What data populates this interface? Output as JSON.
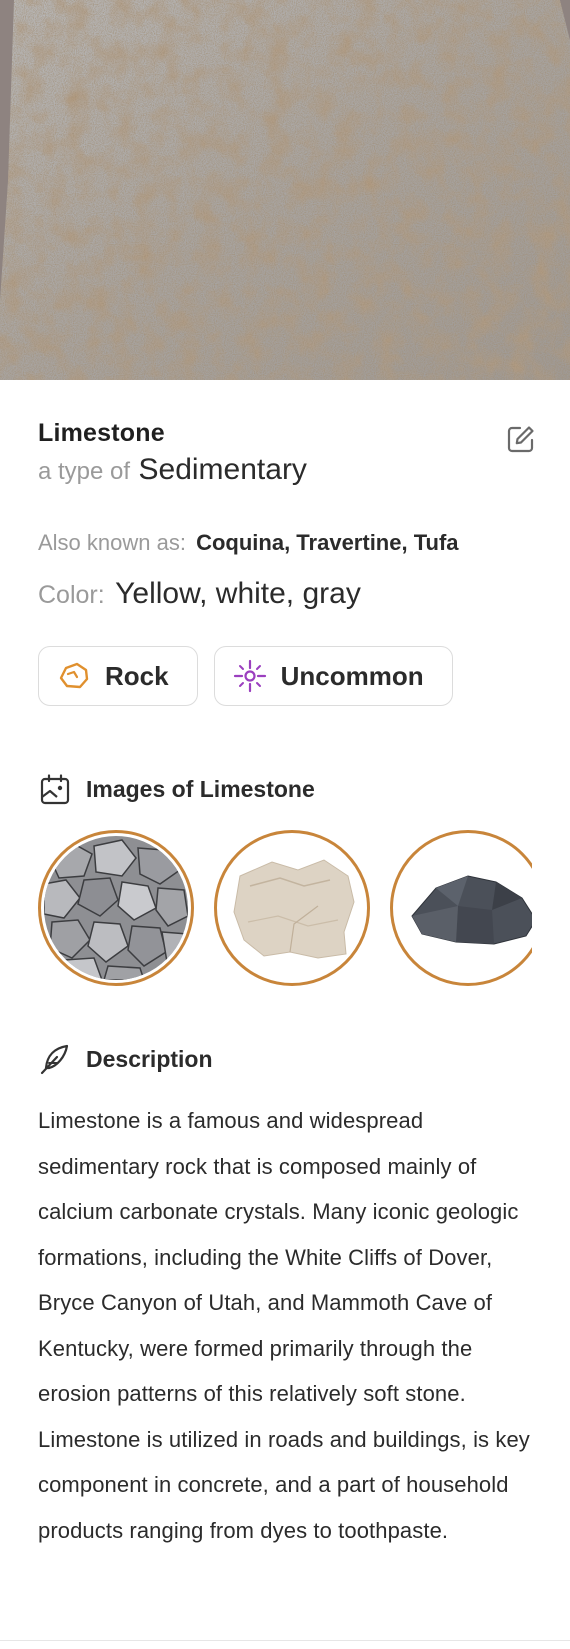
{
  "rock": {
    "name": "Limestone",
    "type_prefix": "a type of",
    "type_value": "Sedimentary",
    "aka_label": "Also known as:",
    "aka_value": "Coquina, Travertine, Tufa",
    "color_label": "Color:",
    "color_value": "Yellow, white, gray"
  },
  "chips": [
    {
      "label": "Rock",
      "icon": "rock-icon",
      "color": "#e0902e"
    },
    {
      "label": "Uncommon",
      "icon": "sparkle-icon",
      "color": "#9b3fbf"
    }
  ],
  "images_section": {
    "title": "Images of Limestone",
    "icon": "image-gallery-icon",
    "thumbnails": [
      "gravel-pile",
      "pale-limestone",
      "dark-gray-rock"
    ]
  },
  "description_section": {
    "title": "Description",
    "icon": "feather-icon",
    "text": "Limestone is a famous and widespread sedimentary rock that is composed mainly of calcium carbonate crystals. Many iconic geologic formations, including the White Cliffs of Dover, Bryce Canyon of Utah, and Mammoth Cave of Kentucky, were formed primarily through the erosion patterns of this relatively soft stone. Limestone is utilized in roads and buildings, is key component in concrete, and a part of household products ranging from dyes to toothpaste."
  },
  "colors": {
    "accent_ring": "#c8853a",
    "muted_text": "#9a9a9a",
    "primary_text": "#2b2b2b"
  }
}
